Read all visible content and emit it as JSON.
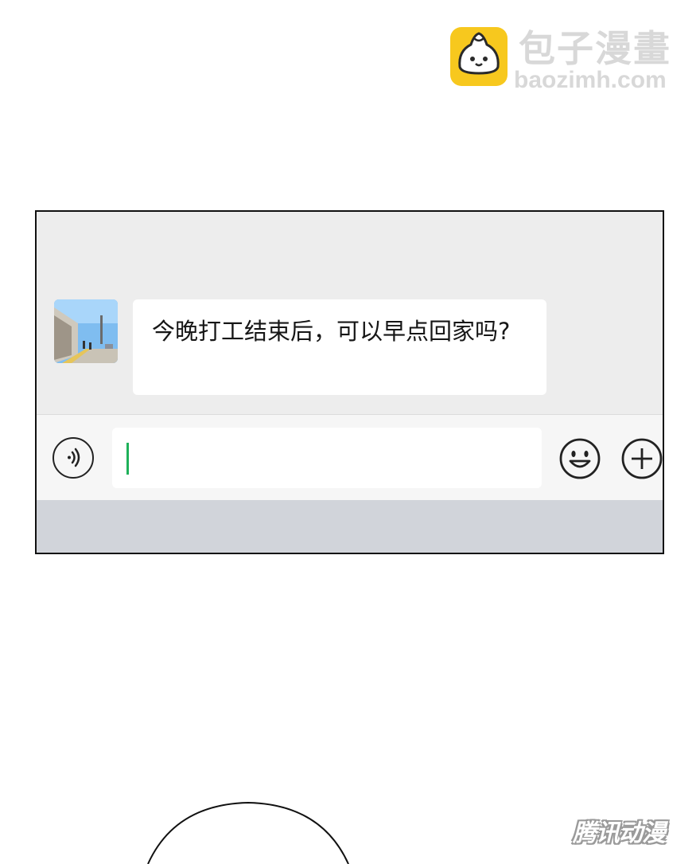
{
  "watermark": {
    "site_name": "包子漫畫",
    "site_url": "baozimh.com",
    "logo_icon": "steamed-bun-icon",
    "logo_color": "#f7c81e"
  },
  "chat": {
    "avatar_icon": "street-photo-avatar",
    "messages": [
      {
        "sender": "contact",
        "text": "今晚打工结束后，可以早点回家吗?"
      }
    ]
  },
  "input_bar": {
    "voice_icon": "voice-icon",
    "input_value": "",
    "emoji_icon": "emoji-icon",
    "plus_icon": "plus-icon",
    "caret_color": "#1fb15a"
  },
  "publisher_watermark": "腾讯动漫"
}
